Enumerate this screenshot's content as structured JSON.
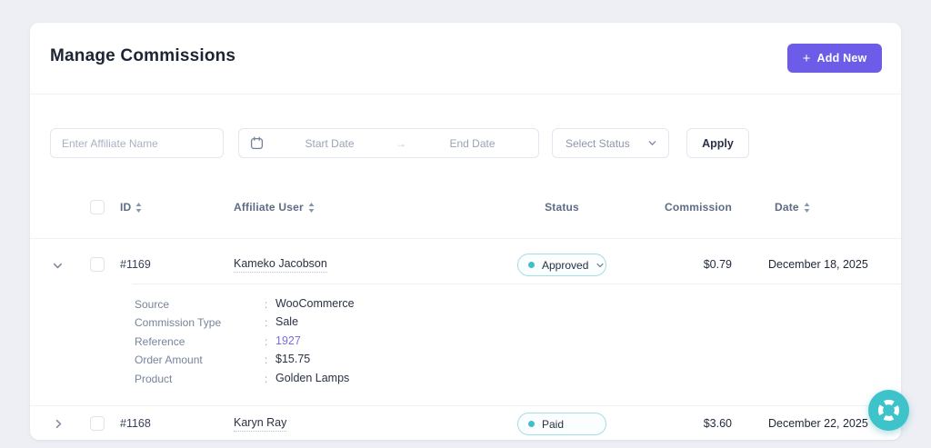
{
  "page": {
    "title": "Manage Commissions"
  },
  "header": {
    "add_new_icon": "+",
    "add_new_label": "Add New"
  },
  "filters": {
    "affiliate_name_placeholder": "Enter Affiliate Name",
    "start_date_placeholder": "Start Date",
    "date_arrow": "→",
    "end_date_placeholder": "End Date",
    "status_placeholder": "Select Status",
    "apply_label": "Apply"
  },
  "table": {
    "columns": [
      {
        "label": "ID",
        "sortable": true
      },
      {
        "label": "Affiliate User",
        "sortable": true
      },
      {
        "label": "Status",
        "sortable": false
      },
      {
        "label": "Commission",
        "sortable": false
      },
      {
        "label": "Date",
        "sortable": true
      }
    ]
  },
  "ui": {
    "colon": ":"
  },
  "rows": [
    {
      "id": "#1169",
      "affiliate": "Kameko Jacobson",
      "status": "Approved",
      "commission": "$0.79",
      "date": "December 18, 2025",
      "expanded": true,
      "details": [
        {
          "label": "Source",
          "value": "WooCommerce"
        },
        {
          "label": "Commission Type",
          "value": "Sale"
        },
        {
          "label": "Reference",
          "value": "1927",
          "is_link": true
        },
        {
          "label": "Order Amount",
          "value": "$15.75"
        },
        {
          "label": "Product",
          "value": "Golden Lamps"
        }
      ]
    },
    {
      "id": "#1168",
      "affiliate": "Karyn Ray",
      "status": "Paid",
      "commission": "$3.60",
      "date": "December 22, 2025",
      "expanded": false
    }
  ],
  "colors": {
    "accent_purple": "#6c5ce7",
    "teal": "#3fc3ca",
    "link_purple": "#7a6fe0",
    "badge_border": "#a5dde1"
  }
}
